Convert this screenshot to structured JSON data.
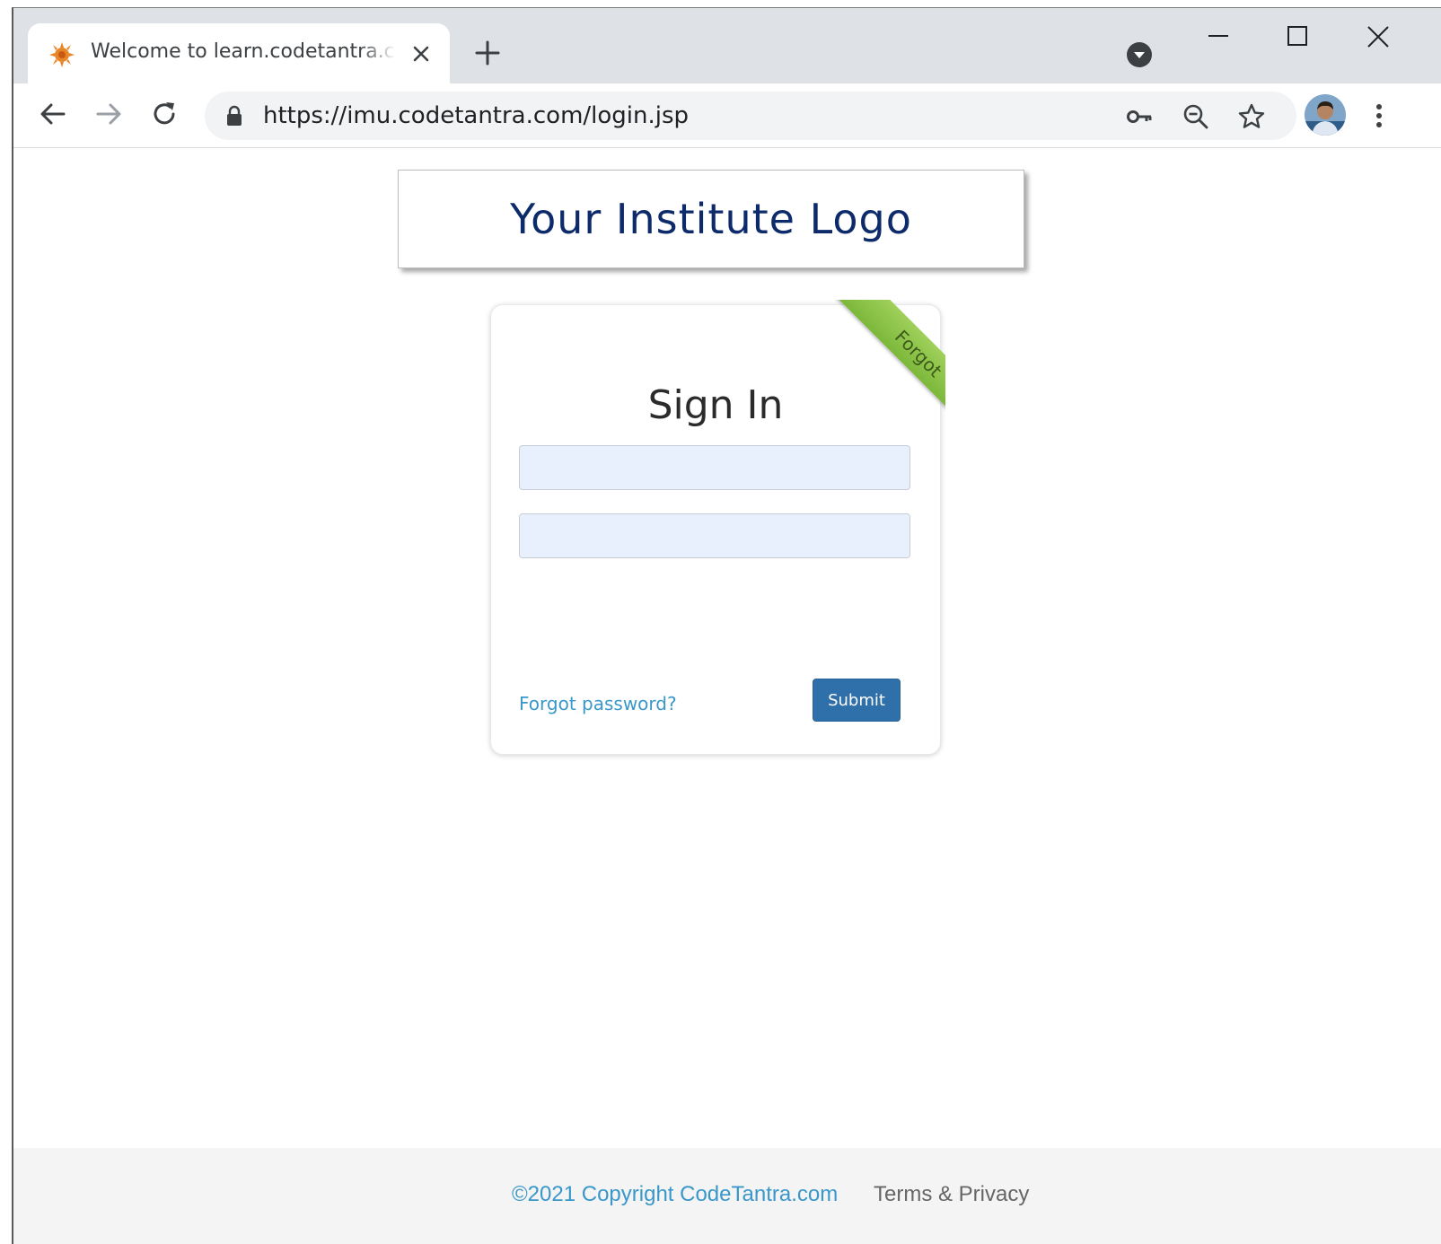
{
  "browser": {
    "tab": {
      "title": "Welcome to learn.codetantra.com",
      "favicon": "codetantra-favicon"
    },
    "address_bar": {
      "url": "https://imu.codetantra.com/login.jsp"
    },
    "icons": {
      "back": "arrow-left-icon",
      "forward": "arrow-right-icon",
      "reload": "reload-icon",
      "lock": "lock-icon",
      "key": "key-icon",
      "zoom": "zoom-out-icon",
      "bookmark": "star-icon",
      "menu": "kebab-menu-icon"
    }
  },
  "page": {
    "logo_text": "Your Institute Logo",
    "login_card": {
      "ribbon_label": "Forgot",
      "title": "Sign In",
      "username": {
        "value": "",
        "placeholder": ""
      },
      "password": {
        "value": "",
        "placeholder": ""
      },
      "forgot_link": "Forgot password?",
      "submit_label": "Submit"
    },
    "footer": {
      "copyright": "©2021 Copyright CodeTantra.com",
      "terms": "Terms & Privacy"
    }
  },
  "colors": {
    "logo_text": "#0d2b6b",
    "ribbon": "#8bc34a",
    "submit_button": "#2f6faa",
    "link": "#3a97c9",
    "input_background": "#e8f0fe"
  }
}
